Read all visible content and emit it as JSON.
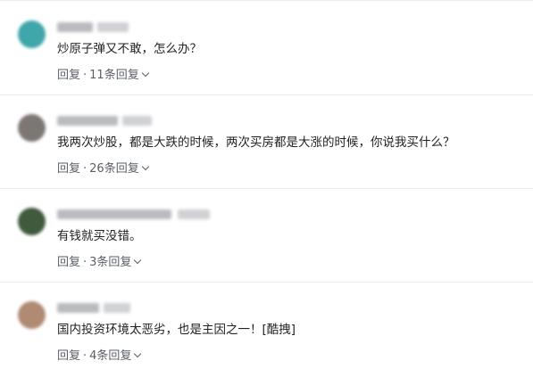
{
  "comments": [
    {
      "text": "炒原子弹又不敢，怎么办？",
      "reply_label": "回复",
      "separator": "·",
      "reply_count": "11条回复",
      "avatar_color": "#3fa6a9"
    },
    {
      "text": "我两次炒股，都是大跌的时候，两次买房都是大涨的时候，你说我买什么？",
      "reply_label": "回复",
      "separator": "·",
      "reply_count": "26条回复",
      "avatar_color": "#7d7774"
    },
    {
      "text": "有钱就买没错。",
      "reply_label": "回复",
      "separator": "·",
      "reply_count": "3条回复",
      "avatar_color": "#3f5a3c"
    },
    {
      "text": "国内投资环境太恶劣，也是主因之一！[酷拽]",
      "reply_label": "回复",
      "separator": "·",
      "reply_count": "4条回复",
      "avatar_color": "#b08a72"
    }
  ]
}
